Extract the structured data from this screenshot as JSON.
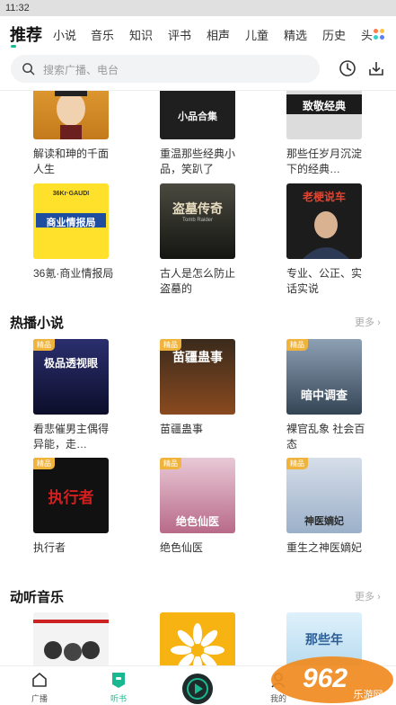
{
  "status": {
    "time": "11:32"
  },
  "tabs": [
    "推荐",
    "小说",
    "音乐",
    "知识",
    "评书",
    "相声",
    "儿童",
    "精选",
    "历史",
    "头"
  ],
  "search": {
    "placeholder": "搜索广播、电台"
  },
  "top_cards": [
    {
      "title": "解读和珅的千面人生",
      "cover_text": ""
    },
    {
      "title": "重温那些经典小品，笑趴了",
      "cover_text": "小品合集"
    },
    {
      "title": "那些任岁月沉淀下的经典…",
      "cover_text": "致敬经典"
    }
  ],
  "row2_cards": [
    {
      "title": "36氪·商业情报局",
      "cover_text": "商业情报局",
      "cover_sub": "36Kr·GAUDI"
    },
    {
      "title": "古人是怎么防止盗墓的",
      "cover_text": "盗墓传奇",
      "cover_sub": "Tomb Raider"
    },
    {
      "title": "专业、公正、实话实说",
      "cover_text": "老梗说车"
    }
  ],
  "section_novels": {
    "title": "热播小说",
    "more": "更多",
    "badge": "精品",
    "cards": [
      {
        "title": "看悲催男主偶得异能，走…",
        "cover_text": "极品透视眼"
      },
      {
        "title": "苗疆蛊事",
        "cover_text": "苗疆蛊事"
      },
      {
        "title": "裸官乱象 社会百态",
        "cover_text": "暗中调查"
      },
      {
        "title": "执行者",
        "cover_text": "执行者"
      },
      {
        "title": "绝色仙医",
        "cover_text": "绝色仙医"
      },
      {
        "title": "重生之神医嫡妃",
        "cover_text": "神医嫡妃"
      }
    ]
  },
  "section_music": {
    "title": "动听音乐",
    "more": "更多",
    "cards": [
      {
        "cover_text": ""
      },
      {
        "cover_text": ""
      },
      {
        "cover_text": "那些年"
      }
    ]
  },
  "bottom_nav": [
    {
      "label": "广播"
    },
    {
      "label": "听书"
    },
    {
      "label": ""
    },
    {
      "label": "我的"
    }
  ],
  "watermark": {
    "text": "962",
    "sub": "乐游网"
  },
  "colors": {
    "accent": "#19b890",
    "badge": "#f0b43c"
  }
}
